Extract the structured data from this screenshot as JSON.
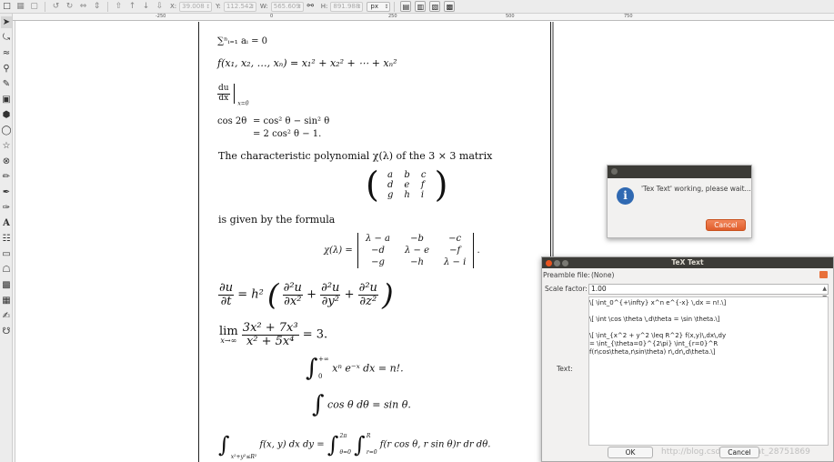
{
  "toolbar": {
    "x_label": "X:",
    "x_value": "39.008",
    "y_label": "Y:",
    "y_value": "112.542",
    "w_label": "W:",
    "w_value": "565.609",
    "h_label": "H:",
    "h_value": "891.988",
    "unit": "px"
  },
  "ruler": [
    "-250",
    "0",
    "250",
    "500",
    "750"
  ],
  "tools": [
    "selector-tool",
    "node-tool",
    "tweak-tool",
    "zoom-tool",
    "measure-tool",
    "rectangle-tool",
    "3d-box-tool",
    "ellipse-tool",
    "star-tool",
    "spiral-tool",
    "pencil-tool",
    "pen-tool",
    "calligraphy-tool",
    "text-tool",
    "spray-tool",
    "eraser-tool",
    "paint-bucket-tool",
    "gradient-tool",
    "mesh-tool",
    "dropper-tool",
    "connector-tool"
  ],
  "doc": {
    "sum": "∑ⁿᵢ₌₁ aᵢ = 0",
    "func": "f(x₁, x₂, …, xₙ) = x₁² + x₂² + ⋯ + xₙ²",
    "du": "du",
    "dx": "dx",
    "eval_at": "x=0",
    "cos_lhs": "cos 2θ",
    "cos_r1": "=   cos² θ − sin² θ",
    "cos_r2": "=   2 cos² θ − 1.",
    "char_poly": "The characteristic polynomial χ(λ) of the 3 × 3 matrix",
    "matrix": [
      [
        "a",
        "b",
        "c"
      ],
      [
        "d",
        "e",
        "f"
      ],
      [
        "g",
        "h",
        "i"
      ]
    ],
    "given_by": "is given by the formula",
    "chi_lhs": "χ(λ) =",
    "det": [
      [
        "λ − a",
        "−b",
        "−c"
      ],
      [
        "−d",
        "λ − e",
        "−f"
      ],
      [
        "−g",
        "−h",
        "λ − i"
      ]
    ],
    "pde_lhs_num": "∂u",
    "pde_lhs_den": "∂t",
    "pde_eq": "= h²",
    "pde_terms": [
      [
        "∂²u",
        "∂x²"
      ],
      [
        "∂²u",
        "∂y²"
      ],
      [
        "∂²u",
        "∂z²"
      ]
    ],
    "lim": "lim",
    "lim_sub": "x→∞",
    "lim_num": "3x² + 7x³",
    "lim_den": "x² + 5x⁴",
    "lim_rhs": "= 3.",
    "int1_upper": "+∞",
    "int1_lower": "0",
    "int1_body": "xⁿ e⁻ˣ dx = n!.",
    "int2_body": "cos θ dθ = sin θ.",
    "int3_lower": "x²+y²≤R²",
    "int3_body": "f(x, y) dx dy =",
    "int3_up2": "2π",
    "int3_lo2": "θ=0",
    "int3_up3": "R",
    "int3_lo3": "r=0",
    "int3_rhs": "f(r cos θ, r sin θ)r dr dθ."
  },
  "info_dialog": {
    "message": "'Tex Text' working, please wait...",
    "cancel_label": "Cancel"
  },
  "tex_dialog": {
    "title": "TeX Text",
    "preamble_label": "Preamble file:",
    "preamble_value": "(None)",
    "scale_label": "Scale factor:",
    "scale_value": "1.00",
    "text_label": "Text:",
    "text_lines": [
      "\\[ \\int_0^{+\\infty} x^n e^{-x} \\,dx = n!.\\]",
      "",
      "\\[ \\int \\cos \\theta \\,d\\theta = \\sin \\theta.\\]",
      "",
      "\\[ \\int_{x^2 + y^2 \\leq R^2} f(x,y)\\,dx\\,dy",
      "= \\int_{\\theta=0}^{2\\pi} \\int_{r=0}^R",
      "f(r\\cos\\theta,r\\sin\\theta) r\\,dr\\,d\\theta.\\]"
    ],
    "ok_label": "OK",
    "cancel_label": "Cancel",
    "watermark": "http://blog.csdn.net/sinat_28751869"
  },
  "colors": {
    "accent_orange": "#e8703a",
    "titlebar": "#3c3b37",
    "info_blue": "#3069b2"
  }
}
